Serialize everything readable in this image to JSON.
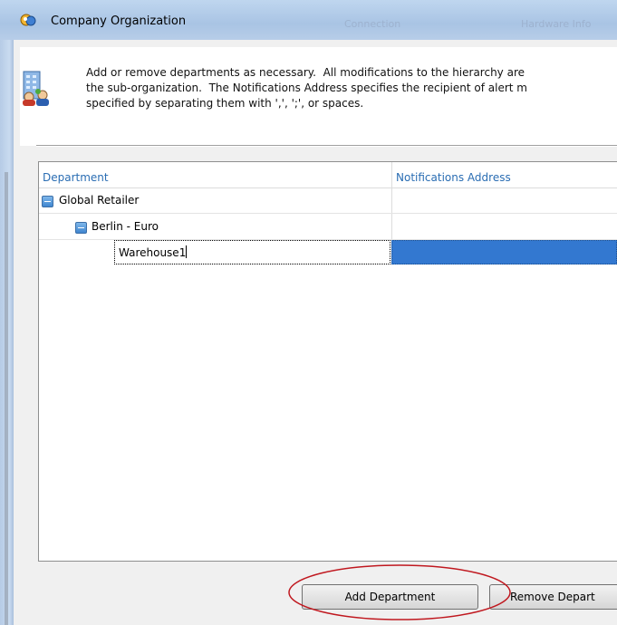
{
  "window": {
    "title": "Company Organization",
    "background_tabs": [
      "Connection",
      "Hardware Info"
    ]
  },
  "header": {
    "icon": "organization-icon",
    "description_lines": [
      "Add or remove departments as necessary.  All modifications to the hierarchy are",
      "the sub-organization.  The Notifications Address specifies the recipient of alert m",
      "specified by separating them with ',', ';', or spaces."
    ]
  },
  "grid": {
    "columns": [
      "Department",
      "Notifications Address"
    ],
    "rows": [
      {
        "name": "Global Retailer",
        "expanded": true,
        "level": 0,
        "address": ""
      },
      {
        "name": "Berlin - Euro",
        "expanded": true,
        "level": 1,
        "address": ""
      }
    ],
    "editing_row": {
      "value": "Warehouse1",
      "level": 2,
      "address_selected": true
    }
  },
  "buttons": {
    "add": "Add Department",
    "remove": "Remove Depart"
  },
  "colors": {
    "header_text": "#2a6db3",
    "selection": "#3378d0",
    "annotation": "#c0181f"
  }
}
